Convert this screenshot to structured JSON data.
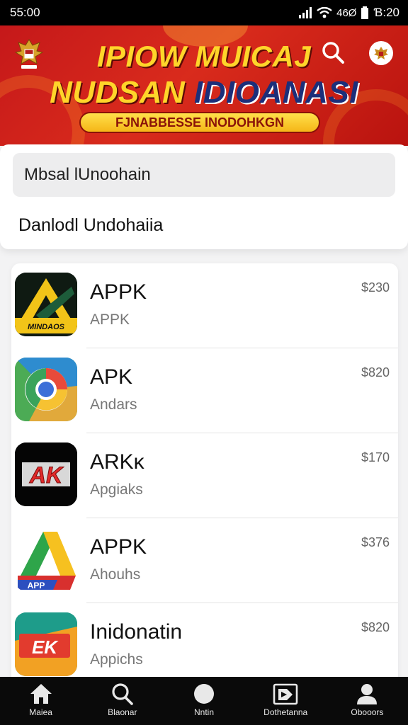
{
  "status_bar": {
    "time": "55:00",
    "network": "46Ø",
    "clock": "Ɓ:20"
  },
  "banner": {
    "title_line1": "IPIOW MUICAJ",
    "title_line2_a": "NUDSAN ",
    "title_line2_b": "IDIOANASI",
    "ribbon": "FJNABBESSE INODOHKGN"
  },
  "search": {
    "value": "Mbsal lUnoohain",
    "suggestion": "Danlodl Undohaiia"
  },
  "apps": [
    {
      "name": "APPK",
      "subtitle": "APPK",
      "price": "$230",
      "icon": "yellow-a-logo-icon",
      "icon_text": "MINDAOS"
    },
    {
      "name": "APK",
      "subtitle": "Andars",
      "price": "$820",
      "icon": "chrome-like-logo-icon"
    },
    {
      "name": "ARKĸ",
      "subtitle": "Apgiaks",
      "price": "$170",
      "icon": "ak-logo-icon",
      "icon_text": "AK"
    },
    {
      "name": "APPK",
      "subtitle": "Ahouhs",
      "price": "$376",
      "icon": "colorful-triangle-logo-icon",
      "icon_text": "APP"
    },
    {
      "name": "Inidonatin",
      "subtitle": "Appichs",
      "price": "$820",
      "icon": "ek-logo-icon",
      "icon_text": "EK"
    }
  ],
  "bottom_nav": [
    {
      "label": "Maiea",
      "icon": "home-icon"
    },
    {
      "label": "Blaonar",
      "icon": "search-icon"
    },
    {
      "label": "Nntin",
      "icon": "circle-icon"
    },
    {
      "label": "Dothetanna",
      "icon": "folder-icon"
    },
    {
      "label": "Obooors",
      "icon": "profile-icon"
    }
  ],
  "colors": {
    "banner_red": "#c5181a",
    "banner_yellow": "#ffd52a",
    "nav_bg": "#0a0a0a"
  }
}
